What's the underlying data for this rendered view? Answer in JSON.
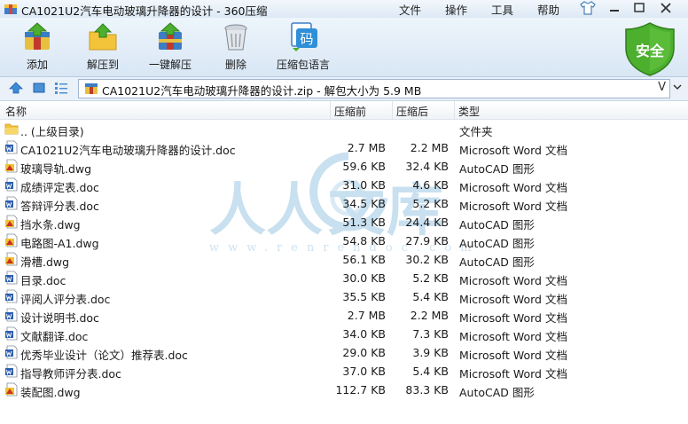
{
  "window": {
    "title": "CA1021U2汽车电动玻璃升降器的设计 - 360压缩",
    "menus": [
      "文件",
      "操作",
      "工具",
      "帮助"
    ]
  },
  "toolbar": {
    "buttons": [
      {
        "label": "添加",
        "icon": "add-archive-icon"
      },
      {
        "label": "解压到",
        "icon": "extract-to-folder-icon"
      },
      {
        "label": "一键解压",
        "icon": "one-click-extract-icon"
      },
      {
        "label": "删除",
        "icon": "trash-bin-icon"
      },
      {
        "label": "压缩包语言",
        "icon": "archive-language-icon"
      }
    ],
    "language_icon_glyph": "码",
    "safe_badge": "安全"
  },
  "address": {
    "path": "CA1021U2汽车电动玻璃升降器的设计.zip - 解包大小为 5.9 MB",
    "dropdown_glyph": "V"
  },
  "columns": {
    "name": "名称",
    "size": "压缩前",
    "packed": "压缩后",
    "type": "类型"
  },
  "files": [
    {
      "name": ".. (上级目录)",
      "size": "",
      "packed": "",
      "type": "文件夹",
      "icon": "folder-icon"
    },
    {
      "name": "CA1021U2汽车电动玻璃升降器的设计.doc",
      "size": "2.7 MB",
      "packed": "2.2 MB",
      "type": "Microsoft Word 文档",
      "icon": "doc-file-icon"
    },
    {
      "name": "玻璃导轨.dwg",
      "size": "59.6 KB",
      "packed": "32.4 KB",
      "type": "AutoCAD 图形",
      "icon": "dwg-file-icon"
    },
    {
      "name": "成绩评定表.doc",
      "size": "31.0 KB",
      "packed": "4.6 KB",
      "type": "Microsoft Word 文档",
      "icon": "doc-file-icon"
    },
    {
      "name": "答辩评分表.doc",
      "size": "34.5 KB",
      "packed": "5.2 KB",
      "type": "Microsoft Word 文档",
      "icon": "doc-file-icon"
    },
    {
      "name": "挡水条.dwg",
      "size": "51.3 KB",
      "packed": "24.4 KB",
      "type": "AutoCAD 图形",
      "icon": "dwg-file-icon"
    },
    {
      "name": "电路图-A1.dwg",
      "size": "54.8 KB",
      "packed": "27.9 KB",
      "type": "AutoCAD 图形",
      "icon": "dwg-file-icon"
    },
    {
      "name": "滑槽.dwg",
      "size": "56.1 KB",
      "packed": "30.2 KB",
      "type": "AutoCAD 图形",
      "icon": "dwg-file-icon"
    },
    {
      "name": "目录.doc",
      "size": "30.0 KB",
      "packed": "5.2 KB",
      "type": "Microsoft Word 文档",
      "icon": "doc-file-icon"
    },
    {
      "name": "评阅人评分表.doc",
      "size": "35.5 KB",
      "packed": "5.4 KB",
      "type": "Microsoft Word 文档",
      "icon": "doc-file-icon"
    },
    {
      "name": "设计说明书.doc",
      "size": "2.7 MB",
      "packed": "2.2 MB",
      "type": "Microsoft Word 文档",
      "icon": "doc-file-icon"
    },
    {
      "name": "文献翻译.doc",
      "size": "34.0 KB",
      "packed": "7.3 KB",
      "type": "Microsoft Word 文档",
      "icon": "doc-file-icon"
    },
    {
      "name": "优秀毕业设计（论文）推荐表.doc",
      "size": "29.0 KB",
      "packed": "3.9 KB",
      "type": "Microsoft Word 文档",
      "icon": "doc-file-icon"
    },
    {
      "name": "指导教师评分表.doc",
      "size": "37.0 KB",
      "packed": "5.4 KB",
      "type": "Microsoft Word 文档",
      "icon": "doc-file-icon"
    },
    {
      "name": "装配图.dwg",
      "size": "112.7 KB",
      "packed": "83.3 KB",
      "type": "AutoCAD 图形",
      "icon": "dwg-file-icon"
    }
  ],
  "watermark": {
    "chars": [
      "人",
      "人",
      "文",
      "库"
    ],
    "url": "www.renrendoc.com"
  },
  "colors": {
    "accent_green": "#4caf2e",
    "title_gradient_top": "#f2f7fc",
    "folder_yellow": "#f3c43a",
    "word_blue": "#2b5fae",
    "cad_red": "#c8312a"
  }
}
